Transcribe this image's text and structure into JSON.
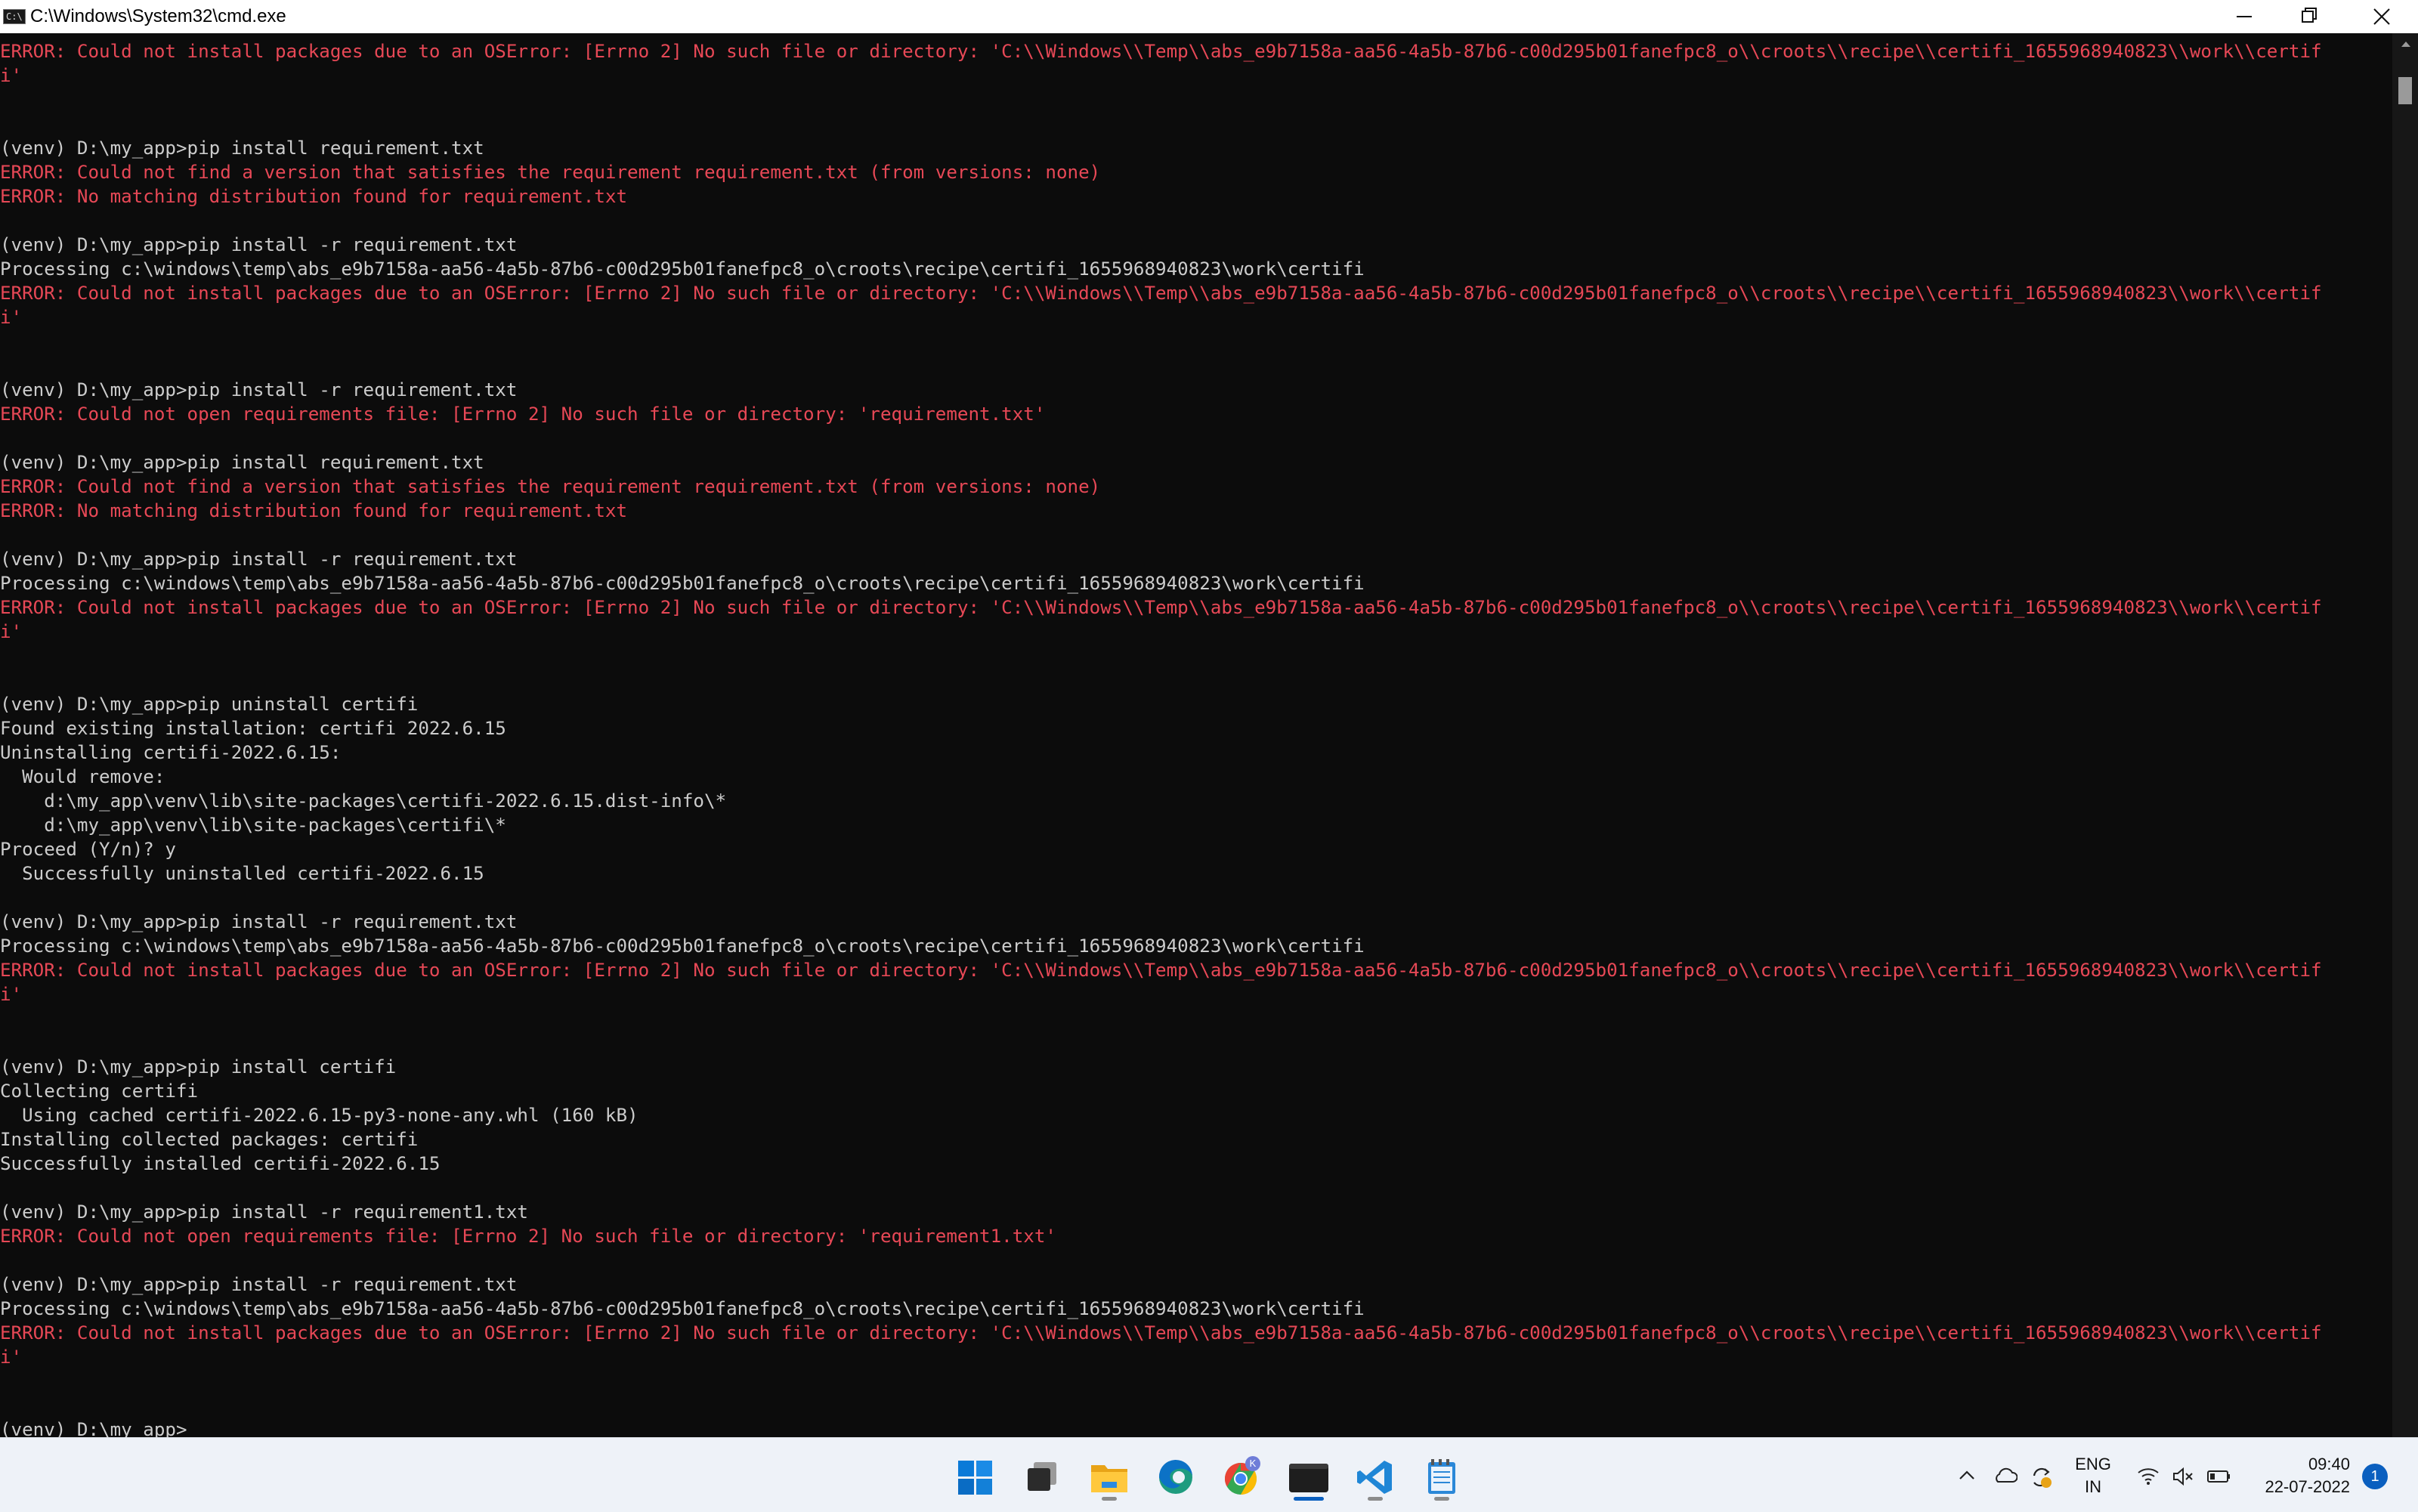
{
  "window": {
    "title": "C:\\Windows\\System32\\cmd.exe",
    "icon_text": "C:\\",
    "controls": [
      "minimize-icon",
      "restore-icon",
      "close-icon"
    ]
  },
  "console": {
    "colors": {
      "normal": "#cccccc",
      "error": "#e74856",
      "background": "#0c0c0c"
    },
    "lines": [
      {
        "t": "ERROR: Could not install packages due to an OSError: [Errno 2] No such file or directory: 'C:\\\\Windows\\\\Temp\\\\abs_e9b7158a-aa56-4a5b-87b6-c00d295b01fanefpc8_o\\\\croots\\\\recipe\\\\certifi_1655968940823\\\\work\\\\certif",
        "k": "err"
      },
      {
        "t": "i'",
        "k": "err"
      },
      {
        "t": "",
        "k": "out"
      },
      {
        "t": "",
        "k": "out"
      },
      {
        "t": "(venv) D:\\my_app>pip install requirement.txt",
        "k": "out"
      },
      {
        "t": "ERROR: Could not find a version that satisfies the requirement requirement.txt (from versions: none)",
        "k": "err"
      },
      {
        "t": "ERROR: No matching distribution found for requirement.txt",
        "k": "err"
      },
      {
        "t": "",
        "k": "out"
      },
      {
        "t": "(venv) D:\\my_app>pip install -r requirement.txt",
        "k": "out"
      },
      {
        "t": "Processing c:\\windows\\temp\\abs_e9b7158a-aa56-4a5b-87b6-c00d295b01fanefpc8_o\\croots\\recipe\\certifi_1655968940823\\work\\certifi",
        "k": "out"
      },
      {
        "t": "ERROR: Could not install packages due to an OSError: [Errno 2] No such file or directory: 'C:\\\\Windows\\\\Temp\\\\abs_e9b7158a-aa56-4a5b-87b6-c00d295b01fanefpc8_o\\\\croots\\\\recipe\\\\certifi_1655968940823\\\\work\\\\certif",
        "k": "err"
      },
      {
        "t": "i'",
        "k": "err"
      },
      {
        "t": "",
        "k": "out"
      },
      {
        "t": "",
        "k": "out"
      },
      {
        "t": "(venv) D:\\my_app>pip install -r requirement.txt",
        "k": "out"
      },
      {
        "t": "ERROR: Could not open requirements file: [Errno 2] No such file or directory: 'requirement.txt'",
        "k": "err"
      },
      {
        "t": "",
        "k": "out"
      },
      {
        "t": "(venv) D:\\my_app>pip install requirement.txt",
        "k": "out"
      },
      {
        "t": "ERROR: Could not find a version that satisfies the requirement requirement.txt (from versions: none)",
        "k": "err"
      },
      {
        "t": "ERROR: No matching distribution found for requirement.txt",
        "k": "err"
      },
      {
        "t": "",
        "k": "out"
      },
      {
        "t": "(venv) D:\\my_app>pip install -r requirement.txt",
        "k": "out"
      },
      {
        "t": "Processing c:\\windows\\temp\\abs_e9b7158a-aa56-4a5b-87b6-c00d295b01fanefpc8_o\\croots\\recipe\\certifi_1655968940823\\work\\certifi",
        "k": "out"
      },
      {
        "t": "ERROR: Could not install packages due to an OSError: [Errno 2] No such file or directory: 'C:\\\\Windows\\\\Temp\\\\abs_e9b7158a-aa56-4a5b-87b6-c00d295b01fanefpc8_o\\\\croots\\\\recipe\\\\certifi_1655968940823\\\\work\\\\certif",
        "k": "err"
      },
      {
        "t": "i'",
        "k": "err"
      },
      {
        "t": "",
        "k": "out"
      },
      {
        "t": "",
        "k": "out"
      },
      {
        "t": "(venv) D:\\my_app>pip uninstall certifi",
        "k": "out"
      },
      {
        "t": "Found existing installation: certifi 2022.6.15",
        "k": "out"
      },
      {
        "t": "Uninstalling certifi-2022.6.15:",
        "k": "out"
      },
      {
        "t": "  Would remove:",
        "k": "out"
      },
      {
        "t": "    d:\\my_app\\venv\\lib\\site-packages\\certifi-2022.6.15.dist-info\\*",
        "k": "out"
      },
      {
        "t": "    d:\\my_app\\venv\\lib\\site-packages\\certifi\\*",
        "k": "out"
      },
      {
        "t": "Proceed (Y/n)? y",
        "k": "out"
      },
      {
        "t": "  Successfully uninstalled certifi-2022.6.15",
        "k": "out"
      },
      {
        "t": "",
        "k": "out"
      },
      {
        "t": "(venv) D:\\my_app>pip install -r requirement.txt",
        "k": "out"
      },
      {
        "t": "Processing c:\\windows\\temp\\abs_e9b7158a-aa56-4a5b-87b6-c00d295b01fanefpc8_o\\croots\\recipe\\certifi_1655968940823\\work\\certifi",
        "k": "out"
      },
      {
        "t": "ERROR: Could not install packages due to an OSError: [Errno 2] No such file or directory: 'C:\\\\Windows\\\\Temp\\\\abs_e9b7158a-aa56-4a5b-87b6-c00d295b01fanefpc8_o\\\\croots\\\\recipe\\\\certifi_1655968940823\\\\work\\\\certif",
        "k": "err"
      },
      {
        "t": "i'",
        "k": "err"
      },
      {
        "t": "",
        "k": "out"
      },
      {
        "t": "",
        "k": "out"
      },
      {
        "t": "(venv) D:\\my_app>pip install certifi",
        "k": "out"
      },
      {
        "t": "Collecting certifi",
        "k": "out"
      },
      {
        "t": "  Using cached certifi-2022.6.15-py3-none-any.whl (160 kB)",
        "k": "out"
      },
      {
        "t": "Installing collected packages: certifi",
        "k": "out"
      },
      {
        "t": "Successfully installed certifi-2022.6.15",
        "k": "out"
      },
      {
        "t": "",
        "k": "out"
      },
      {
        "t": "(venv) D:\\my_app>pip install -r requirement1.txt",
        "k": "out"
      },
      {
        "t": "ERROR: Could not open requirements file: [Errno 2] No such file or directory: 'requirement1.txt'",
        "k": "err"
      },
      {
        "t": "",
        "k": "out"
      },
      {
        "t": "(venv) D:\\my_app>pip install -r requirement.txt",
        "k": "out"
      },
      {
        "t": "Processing c:\\windows\\temp\\abs_e9b7158a-aa56-4a5b-87b6-c00d295b01fanefpc8_o\\croots\\recipe\\certifi_1655968940823\\work\\certifi",
        "k": "out"
      },
      {
        "t": "ERROR: Could not install packages due to an OSError: [Errno 2] No such file or directory: 'C:\\\\Windows\\\\Temp\\\\abs_e9b7158a-aa56-4a5b-87b6-c00d295b01fanefpc8_o\\\\croots\\\\recipe\\\\certifi_1655968940823\\\\work\\\\certif",
        "k": "err"
      },
      {
        "t": "i'",
        "k": "err"
      },
      {
        "t": "",
        "k": "out"
      },
      {
        "t": "",
        "k": "out"
      },
      {
        "t": "(venv) D:\\my_app>",
        "k": "prompt"
      }
    ]
  },
  "taskbar": {
    "apps": [
      {
        "name": "start-icon",
        "active": false
      },
      {
        "name": "task-view-icon",
        "active": false
      },
      {
        "name": "file-explorer-icon",
        "active": false
      },
      {
        "name": "edge-icon",
        "active": false
      },
      {
        "name": "chrome-icon",
        "active": false,
        "badge": "K"
      },
      {
        "name": "terminal-icon",
        "active": true
      },
      {
        "name": "vscode-icon",
        "active": false
      },
      {
        "name": "notepad-icon",
        "active": false
      }
    ],
    "tray": {
      "lang_line1": "ENG",
      "lang_line2": "IN",
      "time": "09:40",
      "date": "22-07-2022",
      "notification_count": "1"
    }
  }
}
